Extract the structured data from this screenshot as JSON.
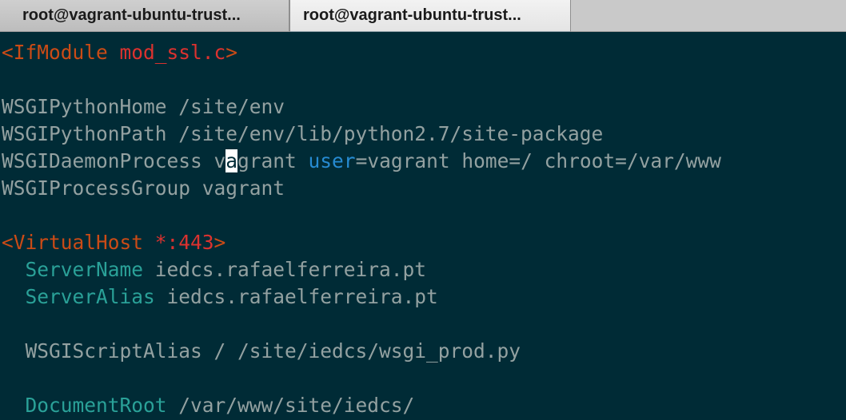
{
  "tabs": [
    {
      "label": "root@vagrant-ubuntu-trust...",
      "active": false
    },
    {
      "label": "root@vagrant-ubuntu-trust...",
      "active": true
    }
  ],
  "terminal": {
    "lines": [
      {
        "segments": [
          {
            "text": "<IfModule ",
            "color": "#cb4b16"
          },
          {
            "text": "mod_ssl.c",
            "color": "#dc322f"
          },
          {
            "text": ">",
            "color": "#cb4b16"
          }
        ]
      },
      {
        "segments": []
      },
      {
        "segments": [
          {
            "text": "WSGIPythonHome /site/env",
            "color": "#93a1a1"
          }
        ]
      },
      {
        "segments": [
          {
            "text": "WSGIPythonPath /site/env/lib/python2.7/site-package",
            "color": "#93a1a1"
          }
        ]
      },
      {
        "segments": [
          {
            "text": "WSGIDaemonProcess v",
            "color": "#93a1a1"
          },
          {
            "text": "a",
            "color": "#002b36",
            "cursor": true
          },
          {
            "text": "grant ",
            "color": "#93a1a1"
          },
          {
            "text": "user",
            "color": "#268bd2"
          },
          {
            "text": "=vagrant home=/ chroot=/var/www",
            "color": "#93a1a1"
          }
        ]
      },
      {
        "segments": [
          {
            "text": "WSGIProcessGroup vagrant",
            "color": "#93a1a1"
          }
        ]
      },
      {
        "segments": []
      },
      {
        "segments": [
          {
            "text": "<VirtualHost ",
            "color": "#cb4b16"
          },
          {
            "text": "*:443",
            "color": "#dc322f"
          },
          {
            "text": ">",
            "color": "#cb4b16"
          }
        ]
      },
      {
        "segments": [
          {
            "text": "  ",
            "color": "#93a1a1"
          },
          {
            "text": "ServerName",
            "color": "#2aa198"
          },
          {
            "text": " iedcs.rafaelferreira.pt",
            "color": "#93a1a1"
          }
        ]
      },
      {
        "segments": [
          {
            "text": "  ",
            "color": "#93a1a1"
          },
          {
            "text": "ServerAlias",
            "color": "#2aa198"
          },
          {
            "text": " iedcs.rafaelferreira.pt",
            "color": "#93a1a1"
          }
        ]
      },
      {
        "segments": []
      },
      {
        "segments": [
          {
            "text": "  WSGIScriptAlias / /site/iedcs/wsgi_prod.py",
            "color": "#93a1a1"
          }
        ]
      },
      {
        "segments": []
      },
      {
        "segments": [
          {
            "text": "  ",
            "color": "#93a1a1"
          },
          {
            "text": "DocumentRoot",
            "color": "#2aa198"
          },
          {
            "text": " /var/www/site/iedcs/",
            "color": "#93a1a1"
          }
        ]
      }
    ]
  },
  "colors": {
    "background": "#002b36",
    "default_text": "#93a1a1",
    "tag": "#cb4b16",
    "tag_arg": "#dc322f",
    "directive": "#2aa198",
    "keyword": "#268bd2",
    "cursor": "#ffffff"
  }
}
